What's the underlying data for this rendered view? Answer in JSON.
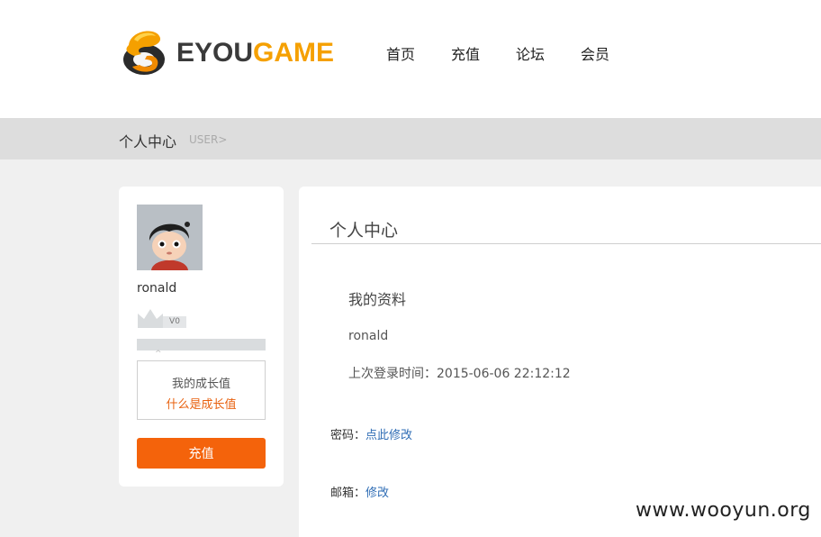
{
  "brand": {
    "logo_part1": "EYOU",
    "logo_part2": "GAME",
    "accent": "#f5a000",
    "dark": "#3a3a3a"
  },
  "nav": {
    "items": [
      {
        "label": "首页"
      },
      {
        "label": "充值"
      },
      {
        "label": "论坛"
      },
      {
        "label": "会员"
      }
    ]
  },
  "breadcrumb": {
    "title": "个人中心",
    "sub": "USER>"
  },
  "sidebar": {
    "username": "ronald",
    "level_badge": "V0",
    "growth_label": "我的成长值",
    "growth_link": "什么是成长值",
    "growth_progress": 0,
    "recharge_label": "充值",
    "button_color": "#f4630b"
  },
  "main": {
    "title": "个人中心",
    "section_title": "我的资料",
    "name": "ronald",
    "last_login": "上次登录时间：2015-06-06 22:12:12",
    "password_label": "密码：",
    "password_link": "点此修改",
    "email_label": "邮箱：",
    "email_link": "修改",
    "link_color": "#2f6db5"
  },
  "watermark": "www.wooyun.org"
}
